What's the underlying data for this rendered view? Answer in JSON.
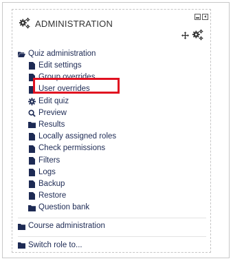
{
  "block": {
    "title": "ADMINISTRATION"
  },
  "quiz_admin": {
    "label": "Quiz administration",
    "items": [
      {
        "label": "Edit settings",
        "icon": "page-icon"
      },
      {
        "label": "Group overrides",
        "icon": "page-icon"
      },
      {
        "label": "User overrides",
        "icon": "page-icon"
      },
      {
        "label": "Edit quiz",
        "icon": "gear-icon"
      },
      {
        "label": "Preview",
        "icon": "search-icon"
      },
      {
        "label": "Results",
        "icon": "folder-icon"
      },
      {
        "label": "Locally assigned roles",
        "icon": "page-icon"
      },
      {
        "label": "Check permissions",
        "icon": "page-icon"
      },
      {
        "label": "Filters",
        "icon": "page-icon"
      },
      {
        "label": "Logs",
        "icon": "page-icon"
      },
      {
        "label": "Backup",
        "icon": "page-icon"
      },
      {
        "label": "Restore",
        "icon": "page-icon"
      },
      {
        "label": "Question bank",
        "icon": "folder-icon"
      }
    ]
  },
  "course_admin": {
    "label": "Course administration"
  },
  "switch_role": {
    "label": "Switch role to..."
  },
  "colors": {
    "link": "#1d2a54",
    "highlight": "#e01020"
  }
}
